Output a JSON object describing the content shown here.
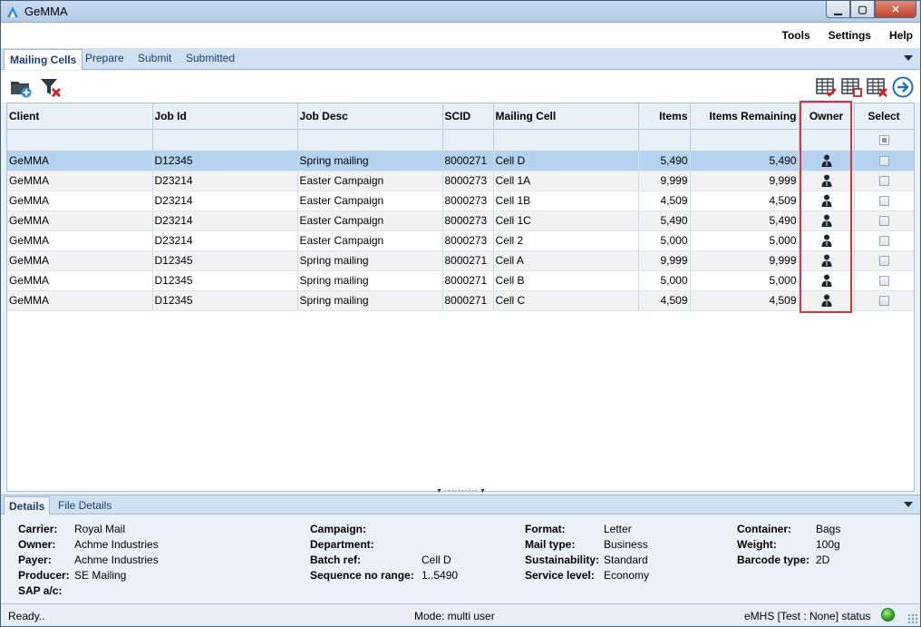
{
  "window": {
    "title": "GeMMA"
  },
  "menu": [
    "Tools",
    "Settings",
    "Help"
  ],
  "tabs": [
    "Mailing Cells",
    "Prepare",
    "Submit",
    "Submitted"
  ],
  "active_tab": "Mailing Cells",
  "grid": {
    "columns": [
      "Client",
      "Job Id",
      "Job Desc",
      "SCID",
      "Mailing Cell",
      "Items",
      "Items Remaining",
      "Owner",
      "Select"
    ],
    "rows": [
      {
        "client": "GeMMA",
        "job_id": "D12345",
        "job_desc": "Spring mailing",
        "scid": "8000271",
        "cell": "Cell D",
        "items": "5,490",
        "remaining": "5,490",
        "selected": true
      },
      {
        "client": "GeMMA",
        "job_id": "D23214",
        "job_desc": "Easter Campaign",
        "scid": "8000273",
        "cell": "Cell 1A",
        "items": "9,999",
        "remaining": "9,999",
        "selected": false
      },
      {
        "client": "GeMMA",
        "job_id": "D23214",
        "job_desc": "Easter Campaign",
        "scid": "8000273",
        "cell": "Cell 1B",
        "items": "4,509",
        "remaining": "4,509",
        "selected": false
      },
      {
        "client": "GeMMA",
        "job_id": "D23214",
        "job_desc": "Easter Campaign",
        "scid": "8000273",
        "cell": "Cell 1C",
        "items": "5,490",
        "remaining": "5,490",
        "selected": false
      },
      {
        "client": "GeMMA",
        "job_id": "D23214",
        "job_desc": "Easter Campaign",
        "scid": "8000273",
        "cell": "Cell 2",
        "items": "5,000",
        "remaining": "5,000",
        "selected": false
      },
      {
        "client": "GeMMA",
        "job_id": "D12345",
        "job_desc": "Spring mailing",
        "scid": "8000271",
        "cell": "Cell A",
        "items": "9,999",
        "remaining": "9,999",
        "selected": false
      },
      {
        "client": "GeMMA",
        "job_id": "D12345",
        "job_desc": "Spring mailing",
        "scid": "8000271",
        "cell": "Cell B",
        "items": "5,000",
        "remaining": "5,000",
        "selected": false
      },
      {
        "client": "GeMMA",
        "job_id": "D12345",
        "job_desc": "Spring mailing",
        "scid": "8000271",
        "cell": "Cell C",
        "items": "4,509",
        "remaining": "4,509",
        "selected": false
      }
    ]
  },
  "details_tabs": [
    "Details",
    "File Details"
  ],
  "details": {
    "carrier": {
      "label": "Carrier:",
      "value": "Royal Mail"
    },
    "owner": {
      "label": "Owner:",
      "value": "Achme Industries"
    },
    "payer": {
      "label": "Payer:",
      "value": "Achme Industries"
    },
    "producer": {
      "label": "Producer:",
      "value": "SE Mailing"
    },
    "sap": {
      "label": "SAP a/c:",
      "value": ""
    },
    "campaign": {
      "label": "Campaign:",
      "value": ""
    },
    "department": {
      "label": "Department:",
      "value": ""
    },
    "batch_ref": {
      "label": "Batch ref:",
      "value": "Cell D"
    },
    "sequence": {
      "label": "Sequence no range:",
      "value": "1..5490"
    },
    "format": {
      "label": "Format:",
      "value": "Letter"
    },
    "mail_type": {
      "label": "Mail type:",
      "value": "Business"
    },
    "sustainability": {
      "label": "Sustainability:",
      "value": "Standard"
    },
    "service_level": {
      "label": "Service level:",
      "value": "Economy"
    },
    "container": {
      "label": "Container:",
      "value": "Bags"
    },
    "weight": {
      "label": "Weight:",
      "value": "100g"
    },
    "barcode": {
      "label": "Barcode type:",
      "value": "2D"
    }
  },
  "status": {
    "left": "Ready..",
    "mode": "Mode: multi user",
    "emhs": "eMHS [Test : None] status",
    "light_color": "#27a51a"
  },
  "colors": {
    "selected_row": "#b5d3f1",
    "highlight_border": "#d3393b",
    "tab_bar": "#cfe0f3"
  }
}
